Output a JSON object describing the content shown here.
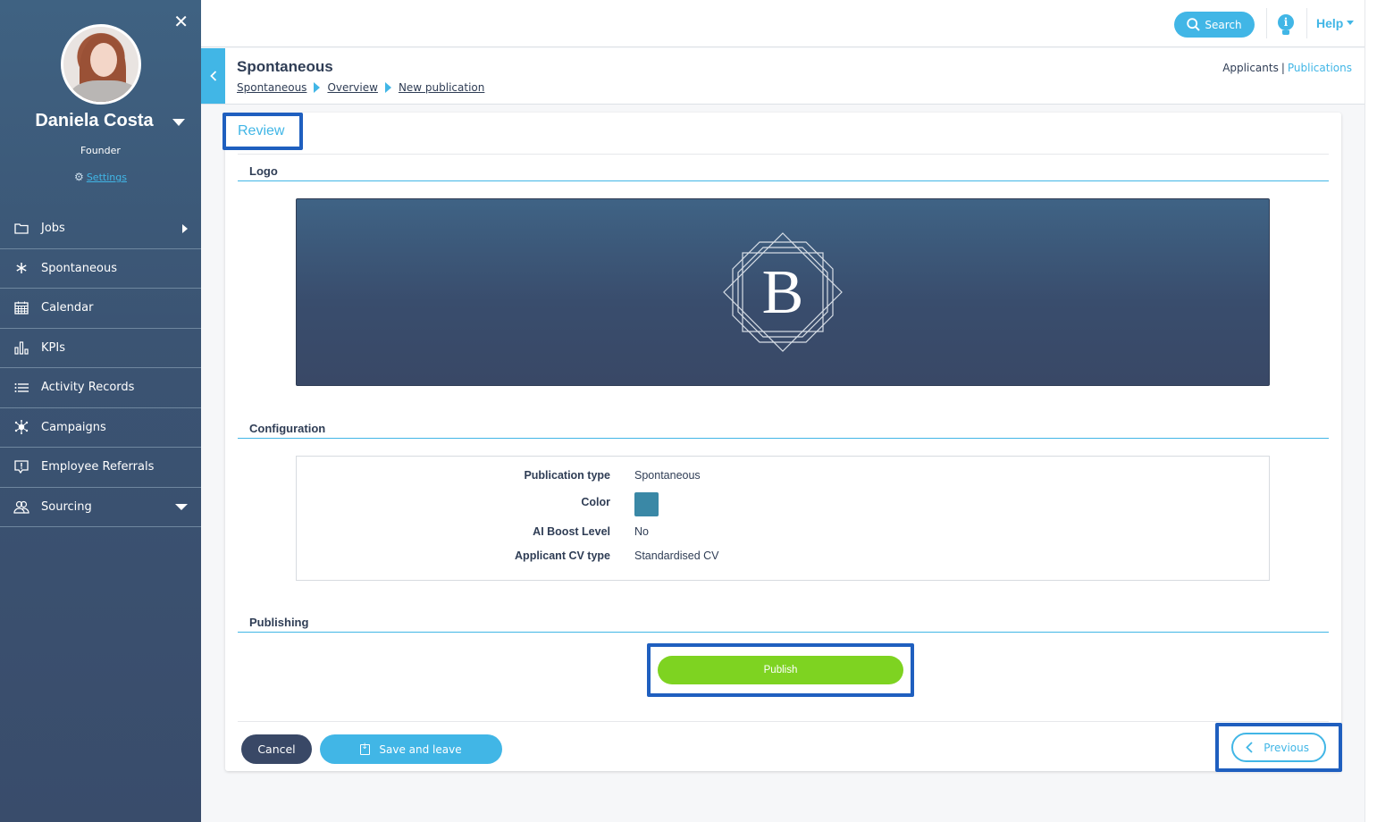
{
  "sidebar": {
    "user": {
      "name": "Daniela Costa",
      "role": "Founder",
      "settings_label": "Settings"
    },
    "items": [
      {
        "label": "Jobs",
        "icon": "folder-icon",
        "indicator": "arrow-right"
      },
      {
        "label": "Spontaneous",
        "icon": "asterisk-icon"
      },
      {
        "label": "Calendar",
        "icon": "calendar-icon"
      },
      {
        "label": "KPIs",
        "icon": "bar-chart-icon"
      },
      {
        "label": "Activity Records",
        "icon": "list-icon"
      },
      {
        "label": "Campaigns",
        "icon": "network-icon"
      },
      {
        "label": "Employee Referrals",
        "icon": "speech-alert-icon"
      },
      {
        "label": "Sourcing",
        "icon": "users-icon",
        "indicator": "arrow-down"
      }
    ]
  },
  "topbar": {
    "search_label": "Search",
    "help_label": "Help"
  },
  "header": {
    "title": "Spontaneous",
    "breadcrumb": [
      "Spontaneous",
      "Overview",
      "New publication"
    ],
    "view_links": {
      "applicants": "Applicants",
      "separator": "|",
      "publications": "Publications"
    }
  },
  "review": {
    "title": "Review",
    "sections": {
      "logo": "Logo",
      "configuration": "Configuration",
      "publishing": "Publishing"
    },
    "logo_letter": "B",
    "configuration": [
      {
        "label": "Publication type",
        "value": "Spontaneous"
      },
      {
        "label": "Color",
        "value": "",
        "swatch": "#3a88a6"
      },
      {
        "label": "AI Boost Level",
        "value": "No"
      },
      {
        "label": "Applicant CV type",
        "value": "Standardised CV"
      }
    ],
    "publish_label": "Publish"
  },
  "footer": {
    "cancel_label": "Cancel",
    "save_label": "Save and leave",
    "previous_label": "Previous"
  },
  "colors": {
    "accent": "#41b6e6",
    "sidebar": "#3b5473",
    "publish": "#7ed321",
    "highlight": "#1f5fbf"
  }
}
